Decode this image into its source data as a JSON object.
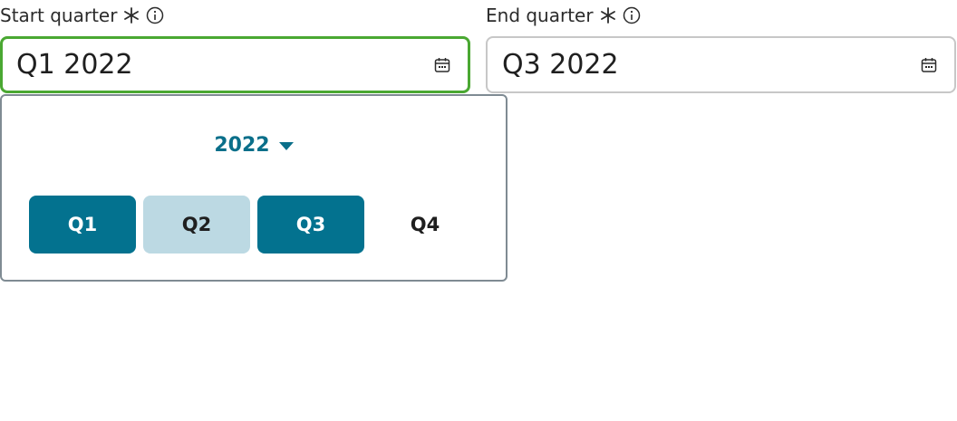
{
  "start": {
    "label": "Start quarter",
    "value": "Q1 2022"
  },
  "end": {
    "label": "End quarter",
    "value": "Q3 2022"
  },
  "picker": {
    "year": "2022",
    "quarters": [
      {
        "label": "Q1",
        "state": "selected"
      },
      {
        "label": "Q2",
        "state": "in-range"
      },
      {
        "label": "Q3",
        "state": "selected"
      },
      {
        "label": "Q4",
        "state": "plain"
      }
    ]
  },
  "colors": {
    "focus": "#4aa832",
    "accent": "#03728f",
    "range": "#bcd9e3"
  },
  "icons": [
    "required-asterisk-icon",
    "info-icon",
    "calendar-icon",
    "caret-down-icon"
  ]
}
